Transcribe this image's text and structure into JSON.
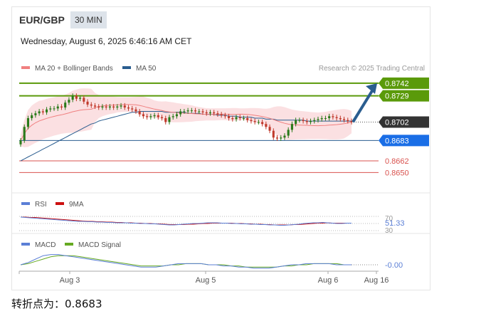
{
  "header": {
    "pair": "EUR/GBP",
    "timeframe": "30 MIN",
    "datetime": "Wednesday, August 6, 2025 6:46:16 AM CET"
  },
  "footer": {
    "pivot_text": "转折点为：0.8683"
  },
  "legend": {
    "ma20": "MA 20 + Bollinger Bands",
    "ma50": "MA 50",
    "credit": "Research © 2025 Trading Central",
    "rsi": "RSI",
    "rsi_ma": "9MA",
    "macd": "MACD",
    "macd_signal": "MACD Signal"
  },
  "colors": {
    "bull": "#2a7a1a",
    "bear": "#c0392b",
    "ma20": "#f08080",
    "bb_fill": "#fadadd",
    "ma50": "#2a5d8f",
    "target": "#5a9a0a",
    "pivot": "#1a6ee6",
    "support": "#d9534f",
    "price_tag": "#333333",
    "arrow": "#2a5d8f",
    "rsi": "#5b7fd6",
    "rsi_ma": "#cc1111",
    "macd": "#5b7fd6",
    "macd_signal": "#66aa22"
  },
  "chart_data": {
    "type": "candlestick",
    "ylim": [
      0.864,
      0.875
    ],
    "x_tick_labels": [
      "Aug 3",
      "Aug 5",
      "Aug 6",
      "Aug 16"
    ],
    "levels": [
      {
        "label": "0.8742",
        "value": 0.8742,
        "kind": "target"
      },
      {
        "label": "0.8729",
        "value": 0.8729,
        "kind": "target"
      },
      {
        "label": "0.8702",
        "value": 0.8702,
        "kind": "current"
      },
      {
        "label": "0.8683",
        "value": 0.8683,
        "kind": "pivot"
      },
      {
        "label": "0.8662",
        "value": 0.8662,
        "kind": "support"
      },
      {
        "label": "0.8650",
        "value": 0.865,
        "kind": "support"
      }
    ],
    "closes": [
      0.8683,
      0.8697,
      0.8706,
      0.8709,
      0.8711,
      0.8713,
      0.8712,
      0.8715,
      0.8716,
      0.8716,
      0.8718,
      0.8717,
      0.8722,
      0.8725,
      0.8729,
      0.8726,
      0.8727,
      0.8723,
      0.872,
      0.8719,
      0.8718,
      0.8717,
      0.8718,
      0.8717,
      0.8718,
      0.8717,
      0.8718,
      0.8719,
      0.8717,
      0.8716,
      0.8715,
      0.8713,
      0.871,
      0.8708,
      0.8707,
      0.8708,
      0.8709,
      0.8707,
      0.8706,
      0.8702,
      0.8707,
      0.8708,
      0.871,
      0.8713,
      0.8713,
      0.8714,
      0.8714,
      0.8713,
      0.8713,
      0.8712,
      0.8711,
      0.8712,
      0.8711,
      0.871,
      0.8709,
      0.8708,
      0.8706,
      0.8705,
      0.8707,
      0.8706,
      0.8706,
      0.8704,
      0.8703,
      0.8702,
      0.8702,
      0.87,
      0.8697,
      0.8693,
      0.8686,
      0.8685,
      0.8686,
      0.8688,
      0.8694,
      0.87,
      0.8704,
      0.8704,
      0.8703,
      0.8702,
      0.8703,
      0.8704,
      0.8705,
      0.8706,
      0.8706,
      0.8708,
      0.8707,
      0.8706,
      0.8705,
      0.8704,
      0.8703,
      0.8702
    ],
    "ma50": [
      0.8662,
      0.8664,
      0.8666,
      0.8668,
      0.867,
      0.8672,
      0.8674,
      0.8676,
      0.8678,
      0.868,
      0.8682,
      0.8684,
      0.8686,
      0.8688,
      0.869,
      0.8692,
      0.8694,
      0.8696,
      0.8698,
      0.87,
      0.8701,
      0.8703,
      0.8704,
      0.8705,
      0.8706,
      0.8707,
      0.8708,
      0.8709,
      0.871,
      0.8711,
      0.8712,
      0.8712,
      0.8713,
      0.8713,
      0.8713,
      0.8713,
      0.8713,
      0.8713,
      0.8713,
      0.8712,
      0.8712,
      0.8712,
      0.8712,
      0.8712,
      0.8712,
      0.8711,
      0.8711,
      0.8711,
      0.8711,
      0.871,
      0.871,
      0.871,
      0.871,
      0.8709,
      0.8709,
      0.8709,
      0.8708,
      0.8708,
      0.8708,
      0.8707,
      0.8707,
      0.8707,
      0.8707,
      0.8706,
      0.8706,
      0.8706,
      0.8705,
      0.8705,
      0.8705,
      0.8704,
      0.8704,
      0.8704,
      0.8704,
      0.8704,
      0.8704,
      0.8704,
      0.8704,
      0.8703,
      0.8703,
      0.8703,
      0.8703,
      0.8703,
      0.8703,
      0.8703,
      0.8703,
      0.8703,
      0.8703,
      0.8703,
      0.8703,
      0.8703
    ],
    "rsi": {
      "levels": [
        "70",
        "51.33",
        "30"
      ],
      "values": [
        68,
        67,
        66,
        65,
        64,
        63,
        62,
        61,
        60,
        59,
        58,
        57,
        56,
        56,
        55,
        55,
        54,
        54,
        53,
        53,
        52,
        52,
        52,
        51,
        51,
        50,
        50,
        49,
        49,
        48,
        47,
        46,
        46,
        47,
        48,
        49,
        50,
        50,
        51,
        52,
        52,
        52,
        51,
        51,
        50,
        50,
        49,
        49,
        48,
        48,
        47,
        47,
        46,
        46,
        45,
        45,
        46,
        47,
        48,
        50,
        51,
        52,
        52,
        53,
        52,
        51,
        50,
        50,
        51,
        51
      ],
      "ma": [
        68,
        68,
        67,
        67,
        66,
        65,
        64,
        63,
        62,
        61,
        60,
        59,
        58,
        57,
        56,
        56,
        55,
        55,
        54,
        54,
        53,
        53,
        52,
        52,
        51,
        51,
        50,
        50,
        49,
        49,
        48,
        47,
        47,
        47,
        47,
        48,
        48,
        49,
        50,
        50,
        51,
        51,
        51,
        51,
        51,
        50,
        50,
        49,
        49,
        48,
        48,
        47,
        47,
        46,
        46,
        46,
        46,
        47,
        47,
        48,
        49,
        50,
        51,
        51,
        52,
        51,
        51,
        51,
        51,
        51
      ]
    },
    "macd": {
      "label": "-0.00",
      "macd": [
        0.0,
        0.2,
        0.5,
        0.8,
        0.9,
        0.9,
        0.8,
        0.7,
        0.6,
        0.5,
        0.4,
        0.3,
        0.2,
        0.1,
        0.0,
        -0.1,
        -0.2,
        -0.2,
        -0.2,
        -0.1,
        0.0,
        0.1,
        0.1,
        0.1,
        0.1,
        0.0,
        0.0,
        -0.1,
        -0.1,
        -0.2,
        -0.2,
        -0.3,
        -0.3,
        -0.3,
        -0.2,
        -0.1,
        0.0,
        0.0,
        0.1,
        0.1,
        0.1,
        0.1,
        0.0,
        0.0,
        0.0
      ],
      "signal": [
        0.0,
        0.1,
        0.3,
        0.5,
        0.7,
        0.8,
        0.8,
        0.8,
        0.7,
        0.6,
        0.5,
        0.4,
        0.3,
        0.2,
        0.1,
        0.0,
        -0.1,
        -0.1,
        -0.1,
        -0.1,
        0.0,
        0.0,
        0.1,
        0.1,
        0.1,
        0.0,
        0.0,
        0.0,
        -0.1,
        -0.1,
        -0.2,
        -0.2,
        -0.2,
        -0.2,
        -0.2,
        -0.1,
        -0.1,
        0.0,
        0.0,
        0.1,
        0.1,
        0.1,
        0.1,
        0.0,
        0.0
      ]
    }
  }
}
